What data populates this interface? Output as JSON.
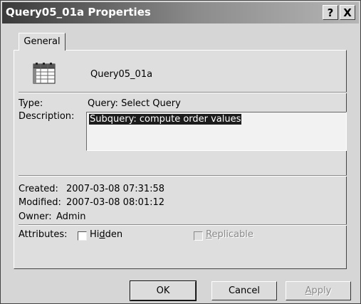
{
  "window": {
    "title": "Query05_01a Properties",
    "help_button": "?",
    "close_button": "X"
  },
  "tabs": [
    {
      "label": "General"
    }
  ],
  "general": {
    "object_name": "Query05_01a",
    "type_label": "Type:",
    "type_value": "Query: Select Query",
    "description_label": "Description:",
    "description_value": "Subquery: compute order values",
    "created_label": "Created:",
    "created_value": "2007-03-08 07:31:58",
    "modified_label": "Modified:",
    "modified_value": "2007-03-08 08:01:12",
    "owner_label": "Owner:",
    "owner_value": "Admin",
    "attributes_label": "Attributes:",
    "hidden_pre": "Hi",
    "hidden_ul": "d",
    "hidden_post": "den",
    "hidden_checked": false,
    "replicable_pre": "",
    "replicable_ul": "R",
    "replicable_post": "eplicable",
    "replicable_checked": false,
    "replicable_enabled": false
  },
  "buttons": {
    "ok": "OK",
    "cancel": "Cancel",
    "apply_ul": "A",
    "apply_post": "pply",
    "apply_enabled": false
  },
  "icon": "query-datasheet-icon"
}
